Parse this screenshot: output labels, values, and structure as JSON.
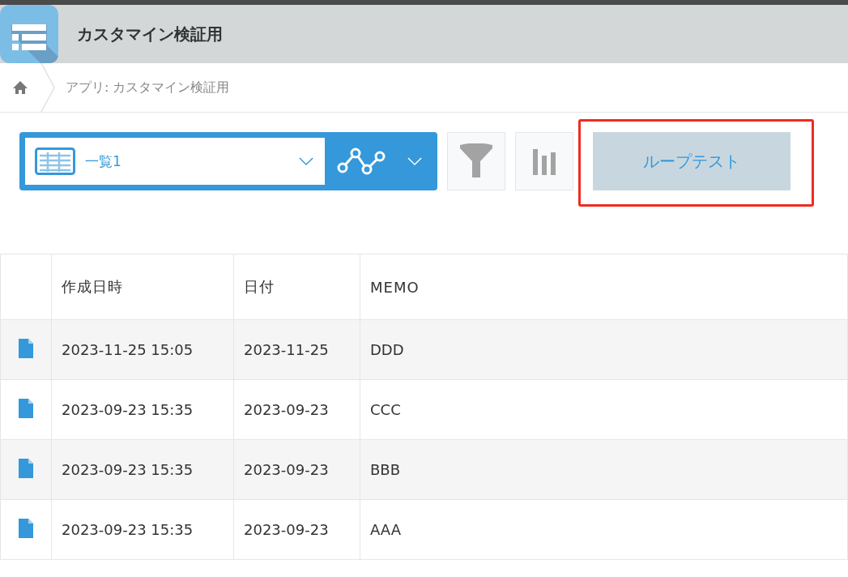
{
  "header": {
    "title": "カスタマイン検証用"
  },
  "breadcrumb": {
    "items": [
      "アプリ: カスタマイン検証用"
    ]
  },
  "toolbar": {
    "view_name": "一覧1",
    "custom_button": "ループテスト"
  },
  "table": {
    "columns": [
      "作成日時",
      "日付",
      "MEMO"
    ],
    "rows": [
      {
        "cells": [
          "2023-11-25 15:05",
          "2023-11-25",
          "DDD"
        ]
      },
      {
        "cells": [
          "2023-09-23 15:35",
          "2023-09-23",
          "CCC"
        ]
      },
      {
        "cells": [
          "2023-09-23 15:35",
          "2023-09-23",
          "BBB"
        ]
      },
      {
        "cells": [
          "2023-09-23 15:35",
          "2023-09-23",
          "AAA"
        ]
      }
    ]
  }
}
